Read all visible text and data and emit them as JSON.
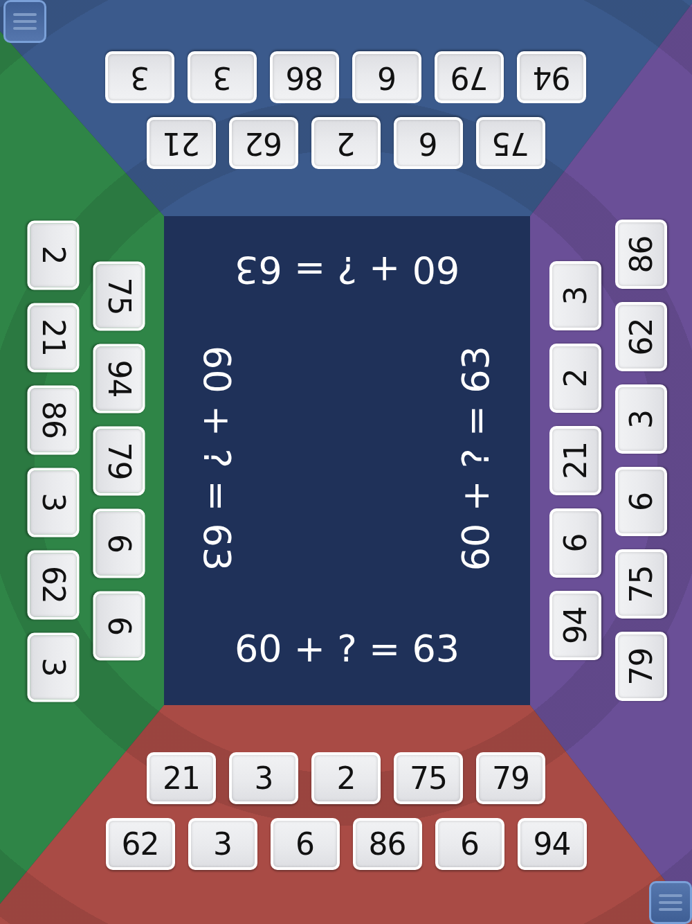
{
  "players": [
    {
      "kind": "top",
      "color": "#3b5a8c",
      "menu_button": true,
      "inner_tiles": [
        "75",
        "6",
        "2",
        "62",
        "21"
      ],
      "outer_tiles": [
        "94",
        "79",
        "6",
        "86",
        "3",
        "3"
      ]
    },
    {
      "kind": "left",
      "color": "#2f8547",
      "inner_tiles": [
        "75",
        "94",
        "79",
        "6",
        "6"
      ],
      "outer_tiles": [
        "2",
        "21",
        "86",
        "3",
        "62",
        "3"
      ]
    },
    {
      "kind": "right",
      "color": "#6a4f97",
      "inner_tiles": [
        "94",
        "6",
        "21",
        "2",
        "3"
      ],
      "outer_tiles": [
        "79",
        "75",
        "6",
        "3",
        "62",
        "86"
      ]
    },
    {
      "kind": "bottom",
      "color": "#a94b45",
      "menu_button": true,
      "inner_tiles": [
        "21",
        "3",
        "2",
        "75",
        "79"
      ],
      "outer_tiles": [
        "62",
        "3",
        "6",
        "86",
        "6",
        "94"
      ]
    }
  ],
  "board": {
    "equations": [
      {
        "kind": "top",
        "text": "60 + ? = 63"
      },
      {
        "kind": "left",
        "text": "60 + ? = 63"
      },
      {
        "kind": "right",
        "text": "60 + ? = 63"
      },
      {
        "kind": "bottom",
        "text": "60 + ? = 63"
      }
    ]
  }
}
